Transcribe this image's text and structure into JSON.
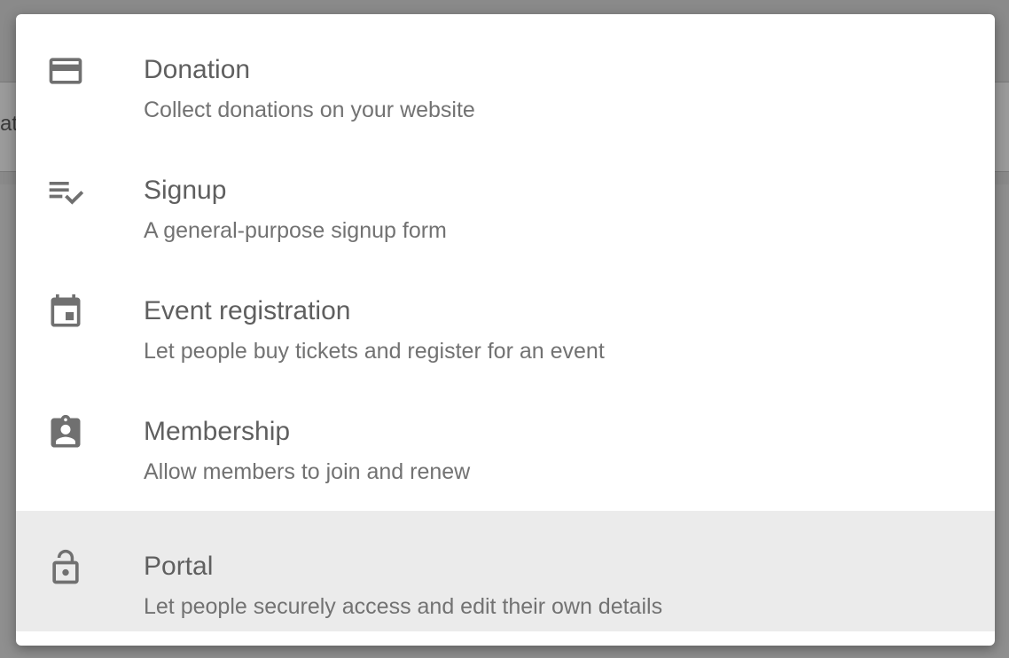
{
  "background": {
    "partial_text": "at"
  },
  "menu": {
    "items": [
      {
        "icon": "credit-card-icon",
        "title": "Donation",
        "description": "Collect donations on your website",
        "selected": false
      },
      {
        "icon": "checklist-icon",
        "title": "Signup",
        "description": "A general-purpose signup form",
        "selected": false
      },
      {
        "icon": "calendar-icon",
        "title": "Event registration",
        "description": "Let people buy tickets and register for an event",
        "selected": false
      },
      {
        "icon": "assignment-ind-icon",
        "title": "Membership",
        "description": "Allow members to join and renew",
        "selected": false
      },
      {
        "icon": "lock-open-icon",
        "title": "Portal",
        "description": "Let people securely access and edit their own details",
        "selected": true
      }
    ]
  },
  "colors": {
    "icon": "#707070",
    "title": "#5f5f5f",
    "description": "#727272",
    "selected_bg": "#ebebeb"
  }
}
